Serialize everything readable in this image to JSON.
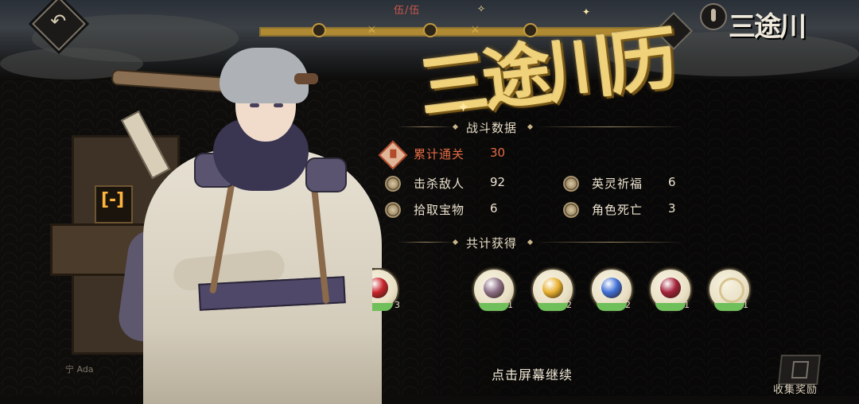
{
  "header": {
    "progress_label": "伍/伍",
    "progress_fraction": 1.0,
    "logo_text": "三途川"
  },
  "title": "三途川历",
  "battle_section": {
    "heading": "战斗数据",
    "stats": [
      {
        "label": "累计通关",
        "value": "30",
        "highlight": true
      },
      {
        "label": "击杀敌人",
        "value": "92"
      },
      {
        "label": "英灵祈福",
        "value": "6"
      },
      {
        "label": "拾取宝物",
        "value": "6"
      },
      {
        "label": "角色死亡",
        "value": "3"
      }
    ]
  },
  "rewards_section": {
    "heading": "共计获得",
    "items": [
      {
        "icon": "red-orb-icon",
        "count": "3",
        "color": "#c8242a"
      },
      {
        "icon": "pouch-icon",
        "count": "1",
        "color": "#8c6f85"
      },
      {
        "icon": "gold-coins-icon",
        "count": "2",
        "color": "#e8b030"
      },
      {
        "icon": "blue-crystal-icon",
        "count": "2",
        "color": "#3f6fd6"
      },
      {
        "icon": "red-bean-icon",
        "count": "1",
        "color": "#a3233a"
      },
      {
        "icon": "rings-icon",
        "count": "1",
        "color": "#d7c490"
      }
    ]
  },
  "footer": {
    "continue_text": "点击屏幕继续",
    "collect_label": "收集奖励",
    "signature": "宁 Ada"
  },
  "colors": {
    "gold": "#f0d27a",
    "highlight": "#e46b45",
    "reward_arc": "#6fbf5a"
  }
}
